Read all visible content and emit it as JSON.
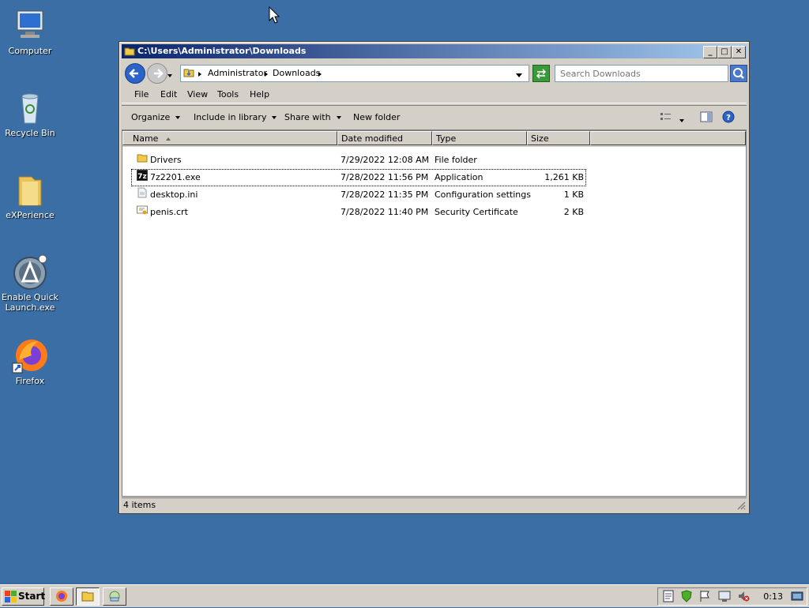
{
  "desktop": {
    "icons": [
      {
        "label": "Computer"
      },
      {
        "label": "Recycle Bin"
      },
      {
        "label": "eXPerience"
      },
      {
        "label": "Enable Quick Launch.exe"
      },
      {
        "label": "Firefox"
      }
    ]
  },
  "window": {
    "title": "C:\\Users\\Administrator\\Downloads",
    "breadcrumb": [
      "Administrator",
      "Downloads"
    ],
    "search_placeholder": "Search Downloads",
    "menu": [
      "File",
      "Edit",
      "View",
      "Tools",
      "Help"
    ],
    "toolbar": {
      "organize": "Organize",
      "include_in_library": "Include in library",
      "share_with": "Share with",
      "new_folder": "New folder"
    },
    "columns": {
      "name": "Name",
      "date": "Date modified",
      "type": "Type",
      "size": "Size"
    },
    "files": [
      {
        "name": "Drivers",
        "date": "7/29/2022 12:08 AM",
        "type": "File folder",
        "size": "",
        "icon": "folder-icon"
      },
      {
        "name": "7z2201.exe",
        "date": "7/28/2022 11:56 PM",
        "type": "Application",
        "size": "1,261 KB",
        "icon": "7zip-icon"
      },
      {
        "name": "desktop.ini",
        "date": "7/28/2022 11:35 PM",
        "type": "Configuration settings",
        "size": "1 KB",
        "icon": "ini-file-icon"
      },
      {
        "name": "penis.crt",
        "date": "7/28/2022 11:40 PM",
        "type": "Security Certificate",
        "size": "2 KB",
        "icon": "certificate-icon"
      }
    ],
    "status": "4 items"
  },
  "taskbar": {
    "start_label": "Start",
    "clock": "0:13"
  },
  "colors": {
    "desktop": "#3a6ea5",
    "titlebar_start": "#0a246a",
    "titlebar_end": "#a6caf0"
  }
}
